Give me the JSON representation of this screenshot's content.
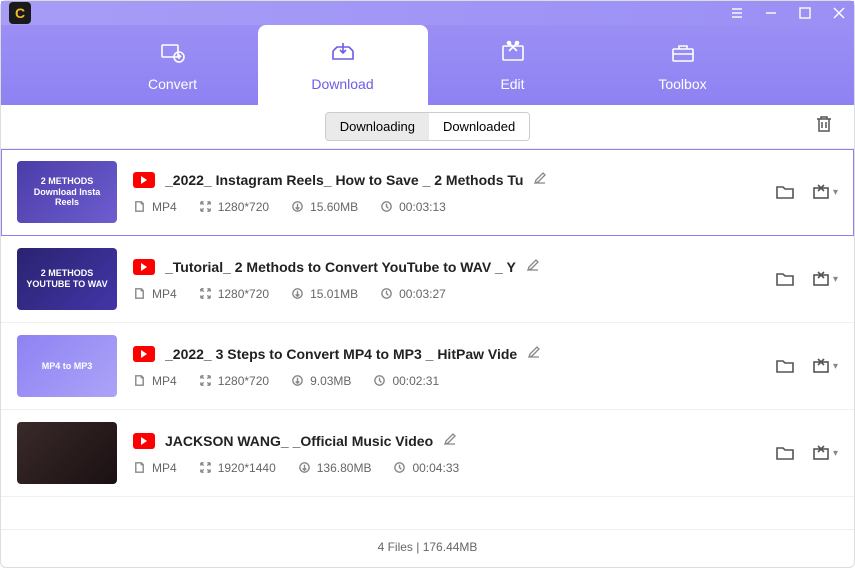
{
  "logo_letter": "C",
  "tabs": [
    {
      "label": "Convert"
    },
    {
      "label": "Download"
    },
    {
      "label": "Edit"
    },
    {
      "label": "Toolbox"
    }
  ],
  "segmented": {
    "downloading": "Downloading",
    "downloaded": "Downloaded"
  },
  "items": [
    {
      "title": "_2022_ Instagram Reels_ How to Save _ 2 Methods Tu",
      "format": "MP4",
      "res": "1280*720",
      "size": "15.60MB",
      "dur": "00:03:13",
      "thumb_text": "2 METHODS Download Insta Reels",
      "thumb_bg": "linear-gradient(135deg,#4b3da8,#6d5dcf)",
      "selected": true
    },
    {
      "title": "_Tutorial_ 2 Methods to Convert YouTube to WAV _ Y",
      "format": "MP4",
      "res": "1280*720",
      "size": "15.01MB",
      "dur": "00:03:27",
      "thumb_text": "2 METHODS YOUTUBE TO WAV",
      "thumb_bg": "linear-gradient(135deg,#2a2370,#4236a8)"
    },
    {
      "title": "_2022_ 3 Steps to Convert MP4 to MP3 _ HitPaw Vide",
      "format": "MP4",
      "res": "1280*720",
      "size": "9.03MB",
      "dur": "00:02:31",
      "thumb_text": "MP4 to MP3",
      "thumb_bg": "linear-gradient(135deg,#8e82f3,#aca4f7)"
    },
    {
      "title": "JACKSON WANG_ _Official Music Video",
      "format": "MP4",
      "res": "1920*1440",
      "size": "136.80MB",
      "dur": "00:04:33",
      "thumb_text": "",
      "thumb_bg": "linear-gradient(135deg,#3a2a2a,#1a1012)"
    }
  ],
  "footer": "4 Files | 176.44MB"
}
